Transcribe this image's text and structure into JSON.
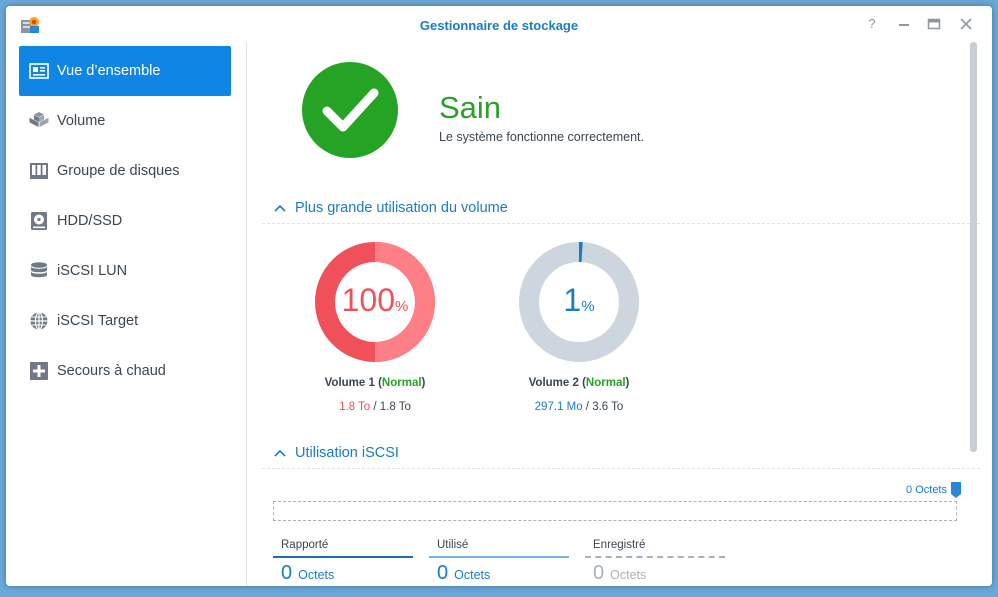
{
  "window": {
    "title": "Gestionnaire de stockage",
    "buttons": [
      "?",
      "–",
      "□",
      "×"
    ]
  },
  "sidebar": {
    "items": [
      {
        "label": "Vue d’ensemble",
        "icon": "overview-icon",
        "active": true
      },
      {
        "label": "Volume",
        "icon": "volume-cubes-icon",
        "active": false
      },
      {
        "label": "Groupe de disques",
        "icon": "disk-group-icon",
        "active": false
      },
      {
        "label": "HDD/SSD",
        "icon": "hdd-icon",
        "active": false
      },
      {
        "label": "iSCSI LUN",
        "icon": "database-icon",
        "active": false
      },
      {
        "label": "iSCSI Target",
        "icon": "globe-icon",
        "active": false
      },
      {
        "label": "Secours à chaud",
        "icon": "hot-spare-icon",
        "active": false
      }
    ]
  },
  "status": {
    "title": "Sain",
    "subtitle": "Le système fonctionne correctement.",
    "color": "#2aa02a"
  },
  "volume_section": {
    "title": "Plus grande utilisation du volume",
    "volumes": [
      {
        "percent": 100,
        "percent_text": "100",
        "percent_sign": "%",
        "name": "Volume 1",
        "paren_open": " (",
        "state": "Normal",
        "paren_close": ")",
        "used": "1.8 To",
        "sep": " / ",
        "total": "1.8 To",
        "color": "#f0505a"
      },
      {
        "percent": 1,
        "percent_text": "1",
        "percent_sign": "%",
        "name": "Volume 2",
        "paren_open": " (",
        "state": "Normal",
        "paren_close": ")",
        "used": "297.1 Mo",
        "sep": " / ",
        "total": "3.6 To",
        "color": "#1a7cc4"
      }
    ]
  },
  "iscsi_section": {
    "title": "Utilisation iSCSI",
    "max_label": "0 Octets",
    "stats": [
      {
        "label": "Rapporté",
        "value": "0",
        "unit": "Octets"
      },
      {
        "label": "Utilisé",
        "value": "0",
        "unit": "Octets"
      },
      {
        "label": "Enregistré",
        "value": "0",
        "unit": "Octets"
      }
    ]
  }
}
